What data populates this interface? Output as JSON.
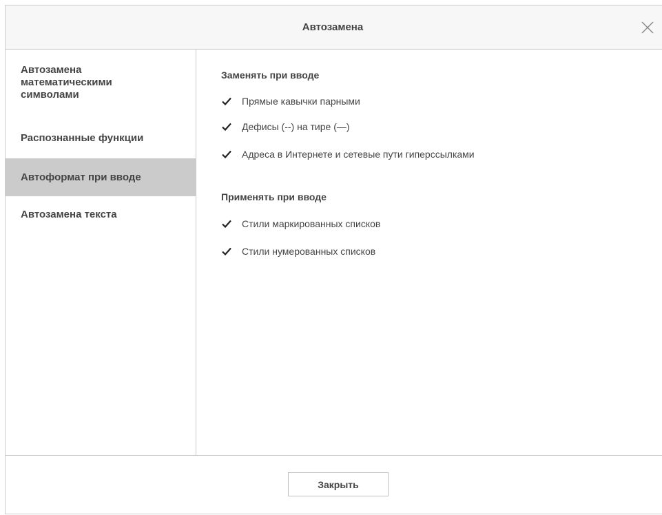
{
  "dialog": {
    "title": "Автозамена",
    "close_label": "Закрыть"
  },
  "sidebar": {
    "items": [
      {
        "lines": [
          "Автозамена",
          "математическими",
          "символами"
        ],
        "active": false
      },
      {
        "lines": [
          "Распознанные функции"
        ],
        "active": false
      },
      {
        "lines": [
          "Автоформат при вводе"
        ],
        "active": true
      },
      {
        "lines": [
          "Автозамена текста"
        ],
        "active": false
      }
    ]
  },
  "replace_section": {
    "title": "Заменять при вводе",
    "options": [
      {
        "label": "Прямые кавычки парными",
        "checked": true
      },
      {
        "label": "Дефисы (--) на тире (—)",
        "checked": true
      },
      {
        "label": "Адреса в Интернете и сетевые пути гиперссылками",
        "checked": true
      }
    ]
  },
  "apply_section": {
    "title": "Применять при вводе",
    "options": [
      {
        "label": "Стили маркированных списков",
        "checked": true
      },
      {
        "label": "Стили нумерованных списков",
        "checked": true
      }
    ]
  },
  "colors": {
    "border": "#cbcbcb",
    "active_item": "#cbcbcb",
    "text": "#444444"
  }
}
